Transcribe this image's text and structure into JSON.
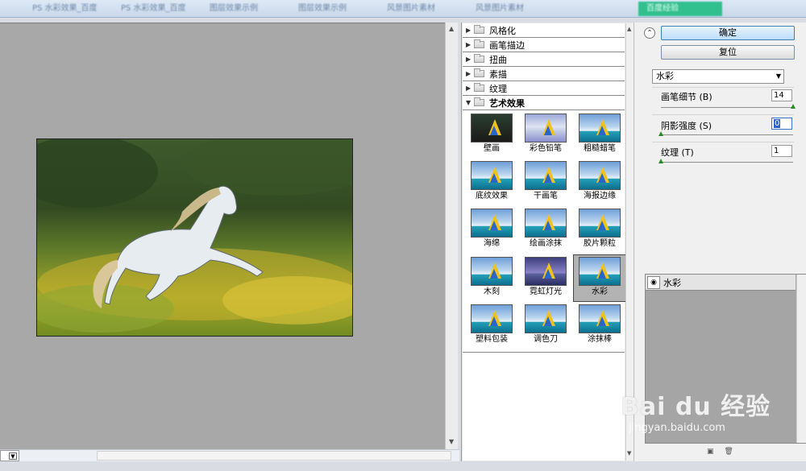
{
  "tabs": [
    "PS 水彩效果_百度",
    "PS 水彩效果_百度",
    "图层效果示例",
    "图层效果示例",
    "风景图片素材",
    "风景图片素材",
    "百度经验"
  ],
  "gallery": {
    "categories": [
      {
        "label": "风格化"
      },
      {
        "label": "画笔描边"
      },
      {
        "label": "扭曲"
      },
      {
        "label": "素描"
      },
      {
        "label": "纹理"
      },
      {
        "label": "艺术效果"
      }
    ],
    "thumbnails": [
      {
        "label": "壁画"
      },
      {
        "label": "彩色铅笔"
      },
      {
        "label": "粗糙蜡笔"
      },
      {
        "label": "底纹效果"
      },
      {
        "label": "干画笔"
      },
      {
        "label": "海报边缘"
      },
      {
        "label": "海绵"
      },
      {
        "label": "绘画涂抹"
      },
      {
        "label": "胶片颗粒"
      },
      {
        "label": "木刻"
      },
      {
        "label": "霓虹灯光"
      },
      {
        "label": "水彩"
      },
      {
        "label": "塑料包装"
      },
      {
        "label": "调色刀"
      },
      {
        "label": "涂抹棒"
      }
    ]
  },
  "settings": {
    "ok_label": "确定",
    "reset_label": "复位",
    "filter_selected": "水彩",
    "params": [
      {
        "label": "画笔细节 (B)",
        "value": "14",
        "level": 1.0
      },
      {
        "label": "阴影强度 (S)",
        "value": "0",
        "level": 0.0
      },
      {
        "label": "纹理 (T)",
        "value": "1",
        "level": 0.0
      }
    ]
  },
  "layers": {
    "active_layer": "水彩"
  },
  "watermark": {
    "main": "Bai du 经验",
    "sub": "jingyan.baidu.com"
  }
}
